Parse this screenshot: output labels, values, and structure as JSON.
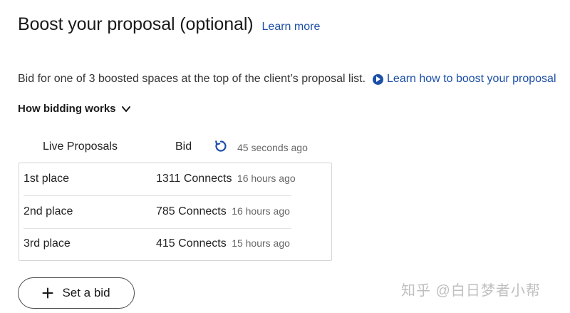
{
  "header": {
    "title": "Boost your proposal (optional)",
    "learn_more": "Learn more"
  },
  "description": {
    "text": "Bid for one of 3 boosted spaces at the top of the client’s proposal list.",
    "boost_link": "Learn how to boost your proposal",
    "boost_link_icon": "play-circle-icon"
  },
  "how_bidding": {
    "label": "How bidding works",
    "icon": "chevron-down-icon"
  },
  "table": {
    "headers": {
      "live": "Live Proposals",
      "bid": "Bid",
      "refresh_icon": "refresh-icon",
      "updated": "45 seconds ago"
    },
    "rows": [
      {
        "place": "1st place",
        "bid": "1311 Connects",
        "time": "16 hours ago"
      },
      {
        "place": "2nd place",
        "bid": "785 Connects",
        "time": "16 hours ago"
      },
      {
        "place": "3rd place",
        "bid": "415 Connects",
        "time": "15 hours ago"
      }
    ]
  },
  "set_bid": {
    "label": "Set a bid",
    "icon": "plus-icon"
  },
  "watermark": {
    "text": "知乎 @白日梦者小帮"
  },
  "colors": {
    "link": "#1c4fa8",
    "text": "#1a1a1a",
    "muted": "#666666",
    "border": "#d5d5d5"
  }
}
